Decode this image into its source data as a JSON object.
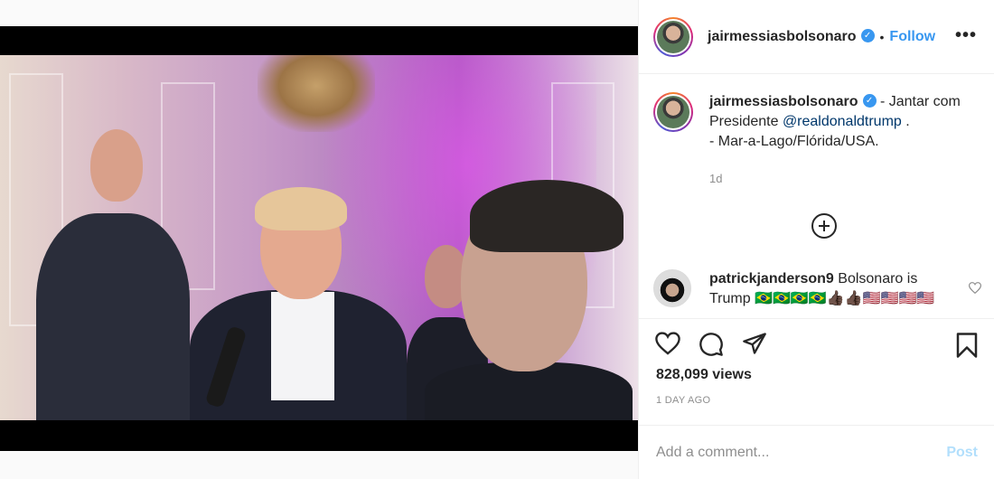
{
  "post": {
    "username": "jairmessiasbolsonaro",
    "verified_badge": "✓",
    "separator": "•",
    "follow_label": "Follow",
    "more_label": "•••",
    "caption": {
      "username": "jairmessiasbolsonaro",
      "text_before": " - Jantar com Presidente ",
      "mention": "@realdonaldtrump",
      "text_after": " .",
      "line2": "- Mar-a-Lago/Flórida/USA."
    },
    "time_ago": "1d",
    "comment": {
      "username": "patrickjanderson9",
      "text": " Bolsonaro is Trump 🇧🇷🇧🇷🇧🇷🇧🇷👍🏿👍🏿🇺🇸🇺🇸🇺🇸🇺🇸"
    },
    "views": "828,099 views",
    "posted": "1 DAY AGO",
    "add_comment_placeholder": "Add a comment...",
    "post_label": "Post"
  },
  "icons": {
    "like": "heart-icon",
    "comment": "comment-icon",
    "share": "share-icon",
    "save": "bookmark-icon",
    "load_more": "plus-circle-icon",
    "comment_like": "heart-small-icon"
  },
  "colors": {
    "accent": "#3897f0",
    "mention": "#00376b",
    "muted": "#8e8e8e",
    "post_disabled": "#b2dffc"
  }
}
